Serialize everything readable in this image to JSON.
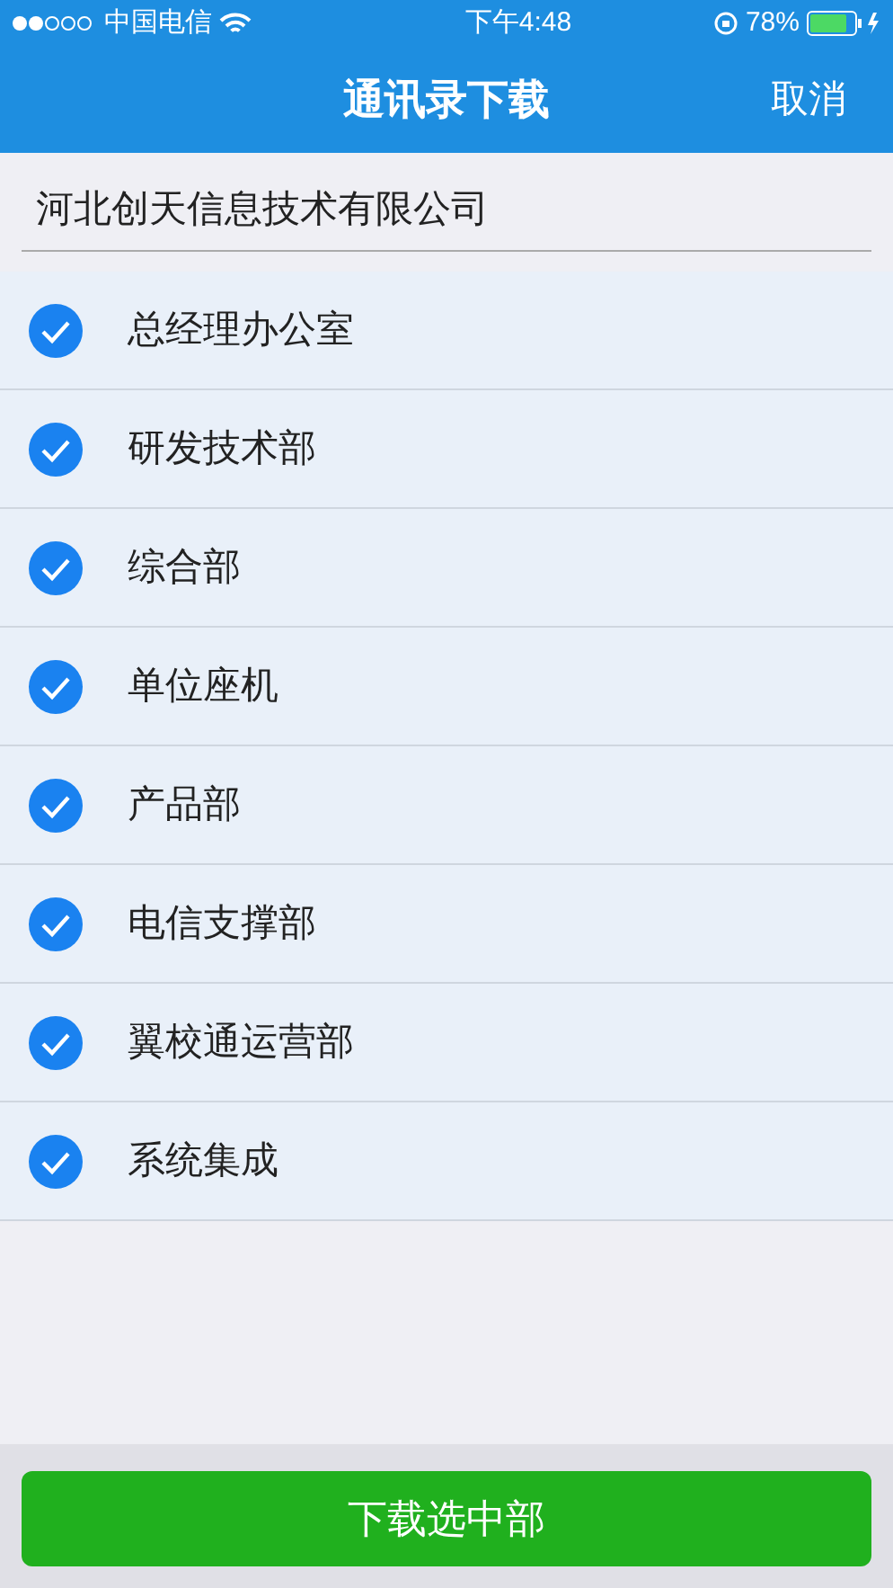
{
  "status_bar": {
    "carrier": "中国电信",
    "time": "下午4:48",
    "battery": "78%"
  },
  "nav": {
    "title": "通讯录下载",
    "action": "取消"
  },
  "company": {
    "name": "河北创天信息技术有限公司"
  },
  "departments": [
    {
      "label": "总经理办公室",
      "checked": true
    },
    {
      "label": "研发技术部",
      "checked": true
    },
    {
      "label": "综合部",
      "checked": true
    },
    {
      "label": "单位座机",
      "checked": true
    },
    {
      "label": "产品部",
      "checked": true
    },
    {
      "label": "电信支撑部",
      "checked": true
    },
    {
      "label": "翼校通运营部",
      "checked": true
    },
    {
      "label": "系统集成",
      "checked": true
    }
  ],
  "download_button": {
    "label": "下载选中部"
  }
}
